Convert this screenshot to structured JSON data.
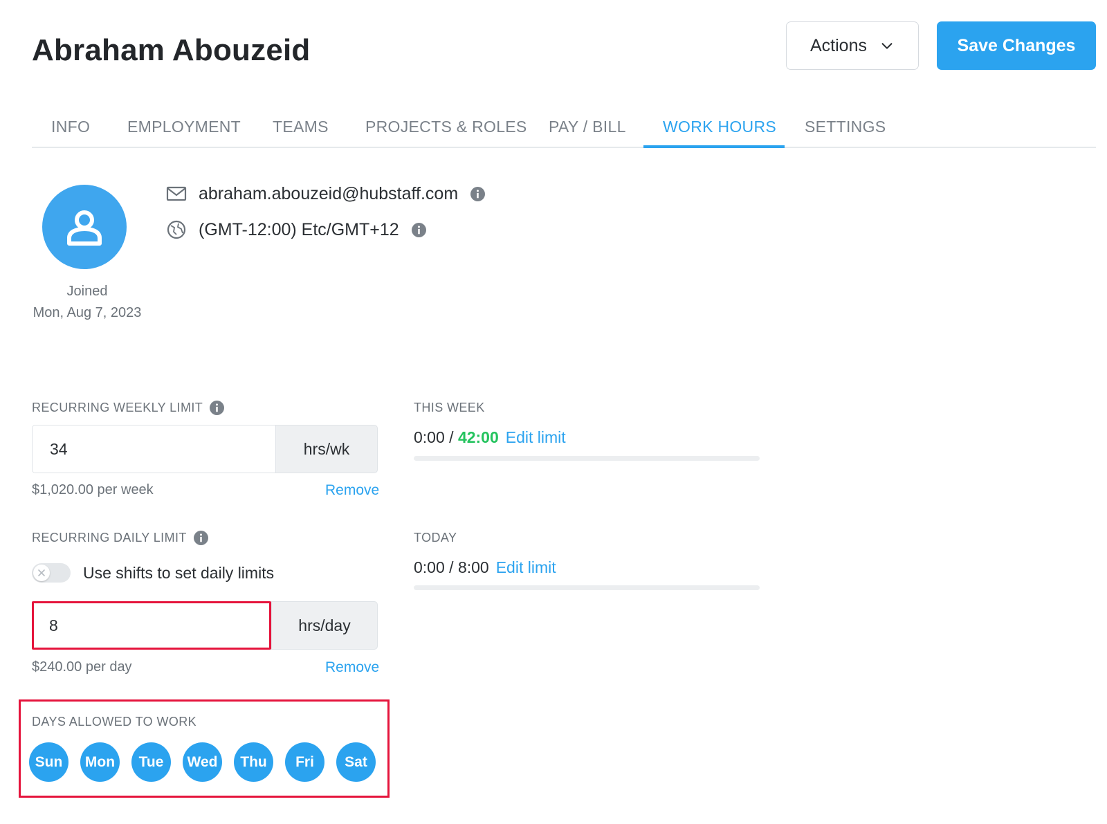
{
  "header": {
    "title": "Abraham Abouzeid",
    "actions_label": "Actions",
    "save_label": "Save Changes"
  },
  "tabs": [
    {
      "label": "INFO"
    },
    {
      "label": "EMPLOYMENT"
    },
    {
      "label": "TEAMS"
    },
    {
      "label": "PROJECTS & ROLES"
    },
    {
      "label": "PAY / BILL"
    },
    {
      "label": "WORK HOURS"
    },
    {
      "label": "SETTINGS"
    }
  ],
  "active_tab": "WORK HOURS",
  "profile": {
    "email": "abraham.abouzeid@hubstaff.com",
    "timezone": "(GMT-12:00) Etc/GMT+12",
    "joined_label": "Joined",
    "joined_date": "Mon, Aug 7, 2023"
  },
  "weekly_limit": {
    "label": "RECURRING WEEKLY LIMIT",
    "value": "34",
    "unit": "hrs/wk",
    "cost": "$1,020.00 per week",
    "remove_label": "Remove"
  },
  "this_week": {
    "label": "THIS WEEK",
    "used": "0:00",
    "separator": " / ",
    "limit": "42:00",
    "edit_label": "Edit limit",
    "progress": 0
  },
  "daily_limit": {
    "label": "RECURRING DAILY LIMIT",
    "toggle_label": "Use shifts to set daily limits",
    "toggle_on": false,
    "value": "8",
    "unit": "hrs/day",
    "cost": "$240.00 per day",
    "remove_label": "Remove"
  },
  "today": {
    "label": "TODAY",
    "used": "0:00",
    "separator": " / ",
    "limit": "8:00",
    "edit_label": "Edit limit",
    "progress": 0
  },
  "days": {
    "label": "DAYS ALLOWED TO WORK",
    "items": [
      {
        "label": "Sun",
        "selected": true
      },
      {
        "label": "Mon",
        "selected": true
      },
      {
        "label": "Tue",
        "selected": true
      },
      {
        "label": "Wed",
        "selected": true
      },
      {
        "label": "Thu",
        "selected": true
      },
      {
        "label": "Fri",
        "selected": true
      },
      {
        "label": "Sat",
        "selected": true
      }
    ]
  },
  "colors": {
    "accent": "#2ba3ef",
    "highlight": "#e5143c",
    "success": "#24c35e"
  }
}
